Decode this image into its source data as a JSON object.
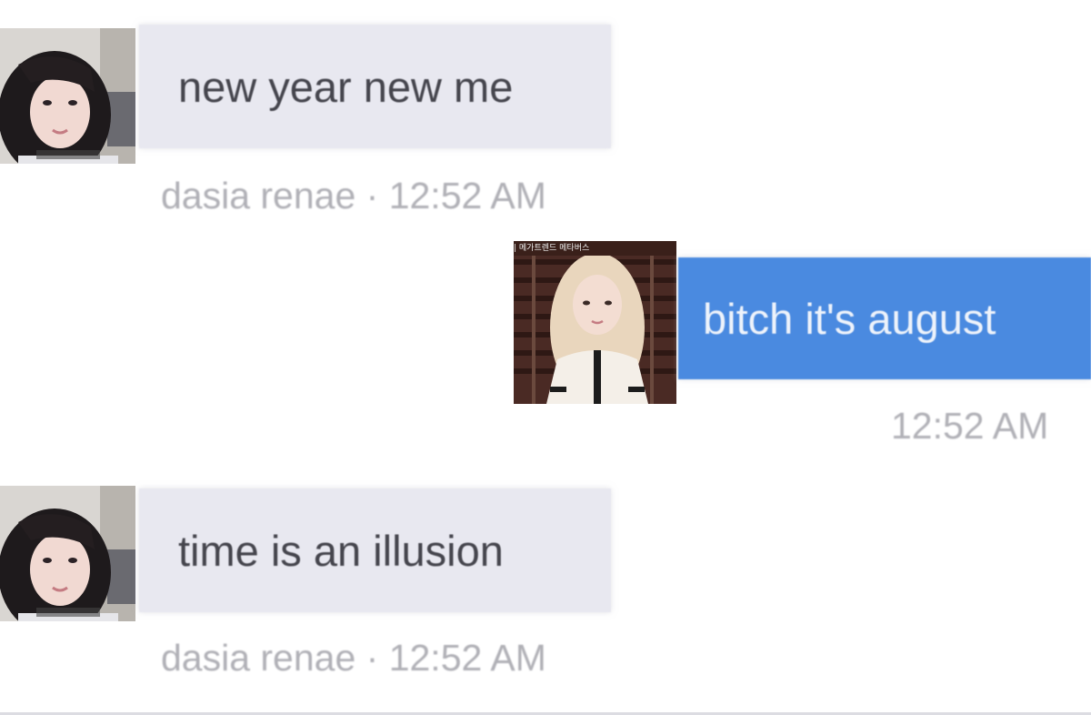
{
  "messages": [
    {
      "direction": "incoming",
      "text": "new year new me",
      "meta": "dasia renae · 12:52 AM",
      "avatar_icon": "person-avatar-dark-hair"
    },
    {
      "direction": "outgoing",
      "text": "bitch it's august",
      "meta": "12:52 AM",
      "avatar_icon": "person-avatar-blonde-hair",
      "avatar_caption": "| 메가트렌드 메타버스"
    },
    {
      "direction": "incoming",
      "text": "time is an illusion",
      "meta": "dasia renae · 12:52 AM",
      "avatar_icon": "person-avatar-dark-hair"
    }
  ],
  "colors": {
    "incoming_bubble": "#e8e8f0",
    "incoming_text": "#45454d",
    "outgoing_bubble": "#4a8ae0",
    "outgoing_text": "#eef3fb",
    "meta_text": "#b0b0b6"
  }
}
